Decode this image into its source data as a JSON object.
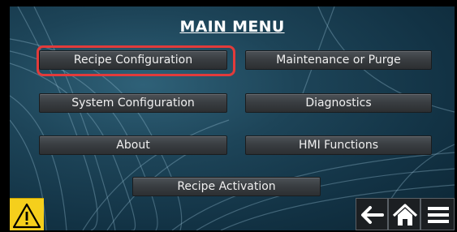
{
  "menu": {
    "title": "MAIN MENU",
    "buttons": {
      "recipe_configuration": "Recipe Configuration",
      "maintenance_or_purge": "Maintenance or Purge",
      "system_configuration": "System Configuration",
      "diagnostics": "Diagnostics",
      "about": "About",
      "hmi_functions": "HMI Functions",
      "recipe_activation": "Recipe Activation"
    },
    "highlighted_button": "recipe_configuration"
  },
  "footer": {
    "warning_icon": "warning-icon",
    "back_icon": "back-arrow-icon",
    "home_icon": "home-icon",
    "menu_icon": "hamburger-menu-icon"
  },
  "colors": {
    "highlight": "#e23b3b",
    "warning": "#f5cf1c",
    "background": "#1d4458"
  }
}
